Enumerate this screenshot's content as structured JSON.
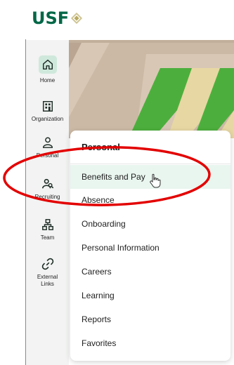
{
  "logo": {
    "text": "USF"
  },
  "sidebar": {
    "items": [
      {
        "label": "Home",
        "icon": "home-icon"
      },
      {
        "label": "Organization",
        "icon": "building-icon"
      },
      {
        "label": "Personal",
        "icon": "person-icon"
      },
      {
        "label": "Recruiting",
        "icon": "people-search-icon"
      },
      {
        "label": "Team",
        "icon": "org-chart-icon"
      },
      {
        "label": "External Links",
        "icon": "link-icon"
      }
    ]
  },
  "menu": {
    "title": "Personal",
    "items": [
      "Benefits and Pay",
      "Absence",
      "Onboarding",
      "Personal Information",
      "Careers",
      "Learning",
      "Reports",
      "Favorites"
    ]
  },
  "colors": {
    "brand": "#006747",
    "accent_gold": "#cfc493",
    "annotation": "#e30000"
  }
}
